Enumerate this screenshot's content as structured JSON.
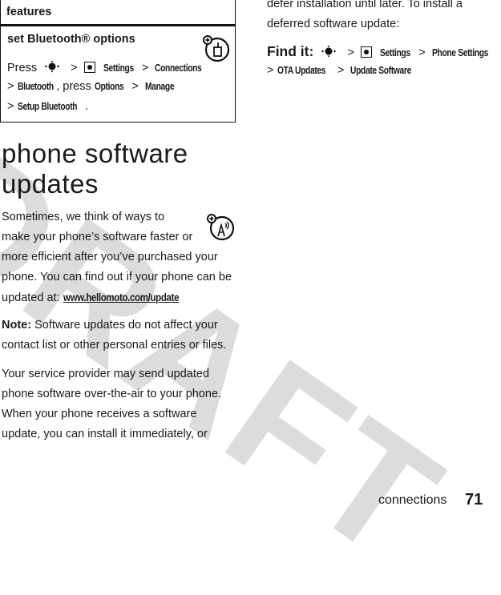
{
  "watermark": "DRAFT",
  "features_table": {
    "header": "features",
    "row_title": "set Bluetooth® options",
    "line1": {
      "press": "Press",
      "settings": "Settings",
      "connections": "Connections"
    },
    "line2": {
      "bluetooth": "Bluetooth",
      "press_word": ", press",
      "options": "Options",
      "manage": "Manage"
    },
    "line3": {
      "setup": "Setup Bluetooth",
      "period": "."
    },
    "separator": ">",
    "icon": "bluetooth-feature-icon"
  },
  "section": {
    "title_line1": "phone software",
    "title_line2": "updates",
    "intro_icon": "network-dependent-feature-icon",
    "intro": [
      "Sometimes, we think of ways to",
      "make your phone’s software faster or",
      "more efficient after you’ve purchased your",
      "phone. You can find out if your phone can be"
    ],
    "intro_last_prefix": "updated at: ",
    "url": "www.hellomoto.com/update",
    "note_label": "Note:",
    "note_text_line1": " Software updates do not affect your",
    "note_text_line2": "contact list or other personal entries or files.",
    "ota": [
      "Your service provider may send updated",
      "phone software over-the-air to your phone.",
      "When your phone receives a software",
      "update, you can install it immediately, or"
    ]
  },
  "column2": {
    "lines": [
      "defer installation until later. To install a",
      "deferred software update:"
    ],
    "find_it_label": "Find it:",
    "path": {
      "settings": "Settings",
      "phone_settings": "Phone Settings",
      "ota_updates": "OTA Updates",
      "update_software": "Update Software"
    }
  },
  "footer": {
    "section_name": "connections",
    "page_number": "71"
  }
}
